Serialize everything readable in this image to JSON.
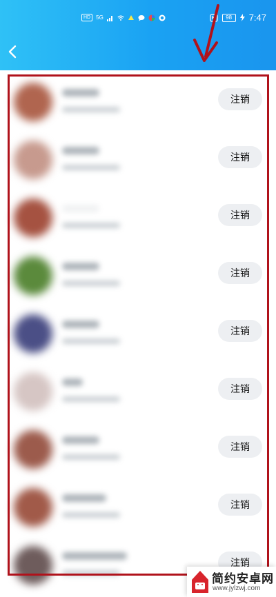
{
  "status_bar": {
    "network_chip": "HD",
    "network_gen": "5G",
    "battery": "98",
    "time": "7:47"
  },
  "nav": {
    "back_icon": "chevron-left-icon"
  },
  "accounts": [
    {
      "action_label": "注销",
      "avatar_color": "#b0654f"
    },
    {
      "action_label": "注销",
      "avatar_color": "#c79a8e"
    },
    {
      "action_label": "注销",
      "avatar_color": "#a55241"
    },
    {
      "action_label": "注销",
      "avatar_color": "#5b8a3c"
    },
    {
      "action_label": "注销",
      "avatar_color": "#4b4f86"
    },
    {
      "action_label": "注销",
      "avatar_color": "#d6c6c4"
    },
    {
      "action_label": "注销",
      "avatar_color": "#9c5b4c"
    },
    {
      "action_label": "注销",
      "avatar_color": "#a15a49"
    },
    {
      "action_label": "注销",
      "avatar_color": "#6e5c5c"
    }
  ],
  "colors": {
    "header": "#1aa2f3",
    "highlight": "#b0121b",
    "button_bg": "#edeff2"
  },
  "watermark": {
    "title": "简约安卓网",
    "url": "www.jylzwj.com"
  }
}
